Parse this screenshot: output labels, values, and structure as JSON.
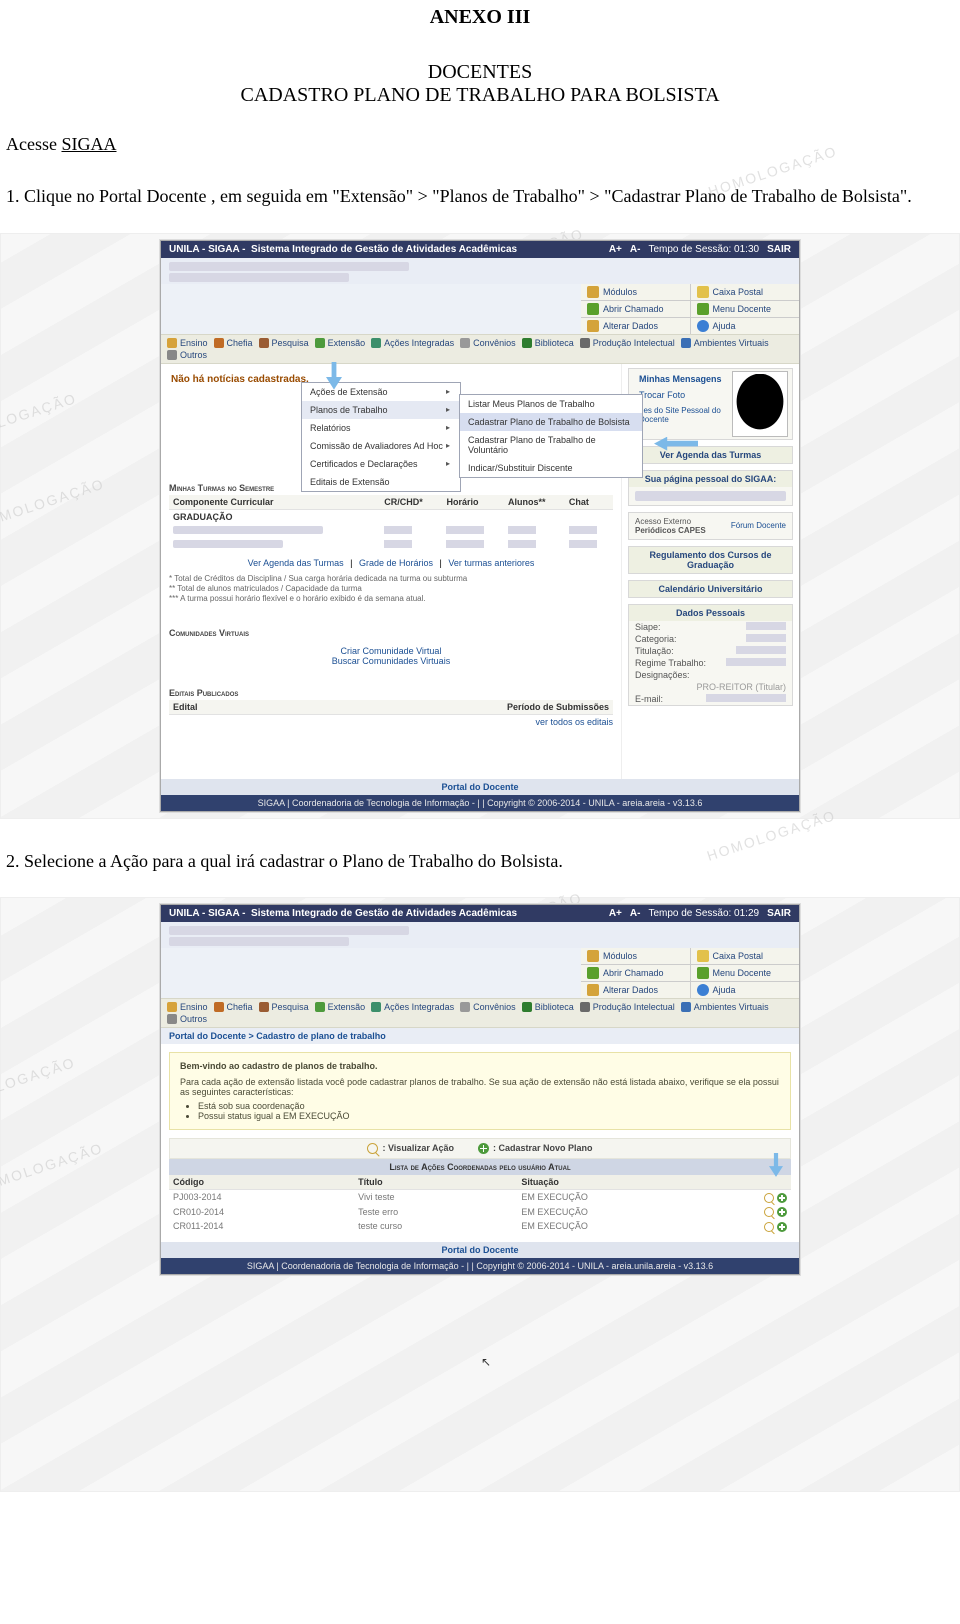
{
  "doc": {
    "anexo": "ANEXO III",
    "sub1": "DOCENTES",
    "sub2": "CADASTRO PLANO DE TRABALHO PARA BOLSISTA",
    "access_prefix": "Acesse ",
    "access_link": "SIGAA",
    "step1": "1. Clique no Portal Docente , em seguida  em \"Extensão\" > \"Planos de Trabalho\" > \"Cadastrar Plano de Trabalho de Bolsista\".",
    "step2": "2. Selecione a Ação para a qual irá cadastrar o Plano de Trabalho do Bolsista."
  },
  "shot1": {
    "sysbar": {
      "title": "UNILA - SIGAA -",
      "subtitle": "Sistema Integrado de Gestão de Atividades Acadêmicas",
      "font_plus": "A+",
      "font_minus": "A-",
      "session": "Tempo de Sessão: 01:30",
      "sair": "SAIR"
    },
    "toplinks": {
      "modulos": "Módulos",
      "caixa": "Caixa Postal",
      "abrir": "Abrir Chamado",
      "menuDoc": "Menu Docente",
      "alterar": "Alterar Dados",
      "ajuda": "Ajuda"
    },
    "menubar": {
      "ensino": "Ensino",
      "chefia": "Chefia",
      "pesquisa": "Pesquisa",
      "extensao": "Extensão",
      "acoes": "Ações Integradas",
      "convenios": "Convênios",
      "biblioteca": "Biblioteca",
      "producao": "Produção Intelectual",
      "ambientes": "Ambientes Virtuais",
      "outros": "Outros"
    },
    "dropdown": {
      "i0": "Ações de Extensão",
      "i1": "Planos de Trabalho",
      "i2": "Relatórios",
      "i3": "Comissão de Avaliadores Ad Hoc",
      "i4": "Certificados e Declarações",
      "i5": "Editais de Extensão"
    },
    "dropdown2": {
      "j0": "Listar Meus Planos de Trabalho",
      "j1": "Cadastrar Plano de Trabalho de Bolsista",
      "j2": "Cadastrar Plano de Trabalho de Voluntário",
      "j3": "Indicar/Substituir Discente"
    },
    "noNews": "Não há notícias cadastradas.",
    "minhasTurmas": "Minhas Turmas no Semestre",
    "turmas": {
      "h_comp": "Componente Curricular",
      "h_crchd": "CR/CHD*",
      "h_hor": "Horário",
      "h_alu": "Alunos**",
      "h_chat": "Chat",
      "grad": "GRADUAÇÃO"
    },
    "links": {
      "agenda": "Ver Agenda das Turmas",
      "grade": "Grade de Horários",
      "anteriores": "Ver turmas anteriores"
    },
    "fine": {
      "l1": "* Total de Créditos da Disciplina / Sua carga horária dedicada na turma ou subturma",
      "l2": "** Total de alunos matriculados / Capacidade da turma",
      "l3": "*** A turma possui horário flexível e o horário exibido é da semana atual."
    },
    "comunidades": {
      "title": "Comunidades Virtuais",
      "criar": "Criar Comunidade Virtual",
      "buscar": "Buscar Comunidades Virtuais"
    },
    "editais": {
      "title": "Editais Publicados",
      "col_edital": "Edital",
      "col_periodo": "Período de Submissões",
      "verTodos": "ver todos os editais"
    },
    "side": {
      "minhasMsg": "Minhas Mensagens",
      "trocarFoto": "Trocar Foto",
      "siteDocente": "des do Site Pessoal do Docente",
      "verAgenda": "Ver Agenda das Turmas",
      "paginaPessoal": "Sua página pessoal do SIGAA:",
      "capesTop": "Acesso Externo",
      "capesMain": "Periódicos CAPES",
      "forum": "Fórum Docente",
      "regulamento": "Regulamento dos Cursos de Graduação",
      "calendario": "Calendário Universitário",
      "dados": "Dados Pessoais",
      "siape": "Siape:",
      "categoria": "Categoria:",
      "titulacao": "Titulação:",
      "regime": "Regime Trabalho:",
      "desig": "Designações:",
      "desigVal": "PRO-REITOR (Titular)",
      "email": "E-mail:"
    },
    "portalDocente": "Portal do Docente",
    "footer": "SIGAA | Coordenadoria de Tecnologia de Informação - | | Copyright © 2006-2014 - UNILA - areia.areia - v3.13.6"
  },
  "shot2": {
    "sysbar": {
      "title": "UNILA - SIGAA -",
      "subtitle": "Sistema Integrado de Gestão de Atividades Acadêmicas",
      "font_plus": "A+",
      "font_minus": "A-",
      "session": "Tempo de Sessão: 01:29",
      "sair": "SAIR"
    },
    "breadcrumb": "Portal do Docente > Cadastro de plano de trabalho",
    "welcome": {
      "title": "Bem-vindo ao cadastro de planos de trabalho.",
      "text": "Para cada ação de extensão listada você pode cadastrar planos de trabalho. Se sua ação de extensão não está listada abaixo, verifique se ela possui as seguintes características:",
      "b1": "Está sob sua coordenação",
      "b2": "Possui status igual a EM EXECUÇÃO"
    },
    "legend": {
      "vis": ": Visualizar Ação",
      "cad": ": Cadastrar Novo Plano"
    },
    "listTitle": "Lista de Ações Coordenadas pelo usuário Atual",
    "tbl": {
      "h_cod": "Código",
      "h_tit": "Título",
      "h_sit": "Situação",
      "rows": [
        {
          "cod": "PJ003-2014",
          "tit": "Vivi teste",
          "sit": "EM EXECUÇÃO"
        },
        {
          "cod": "CR010-2014",
          "tit": "Teste erro",
          "sit": "EM EXECUÇÃO"
        },
        {
          "cod": "CR011-2014",
          "tit": "teste curso",
          "sit": "EM EXECUÇÃO"
        }
      ]
    },
    "portalDocente": "Portal do Docente",
    "footer": "SIGAA | Coordenadoria de Tecnologia de Informação - | | Copyright © 2006-2014 - UNILA - areia.unila.areia - v3.13.6"
  }
}
